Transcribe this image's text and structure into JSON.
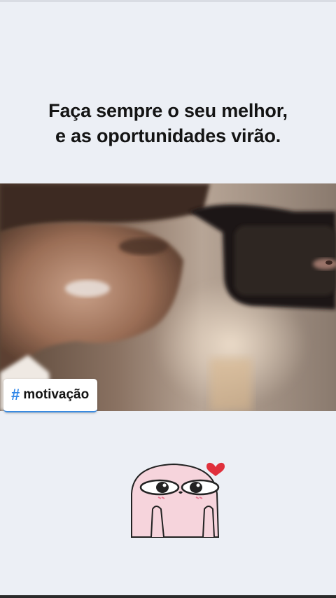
{
  "caption": {
    "line1": "Faça sempre o seu melhor,",
    "line2": "e as oportunidades virão."
  },
  "hashtag": {
    "symbol": "#",
    "text": "motivação"
  },
  "sticker": {
    "icon": "blushing-blob-with-heart"
  },
  "colors": {
    "background": "#eceff5",
    "hashtag_accent": "#2f86e8",
    "heart": "#e0303c"
  }
}
